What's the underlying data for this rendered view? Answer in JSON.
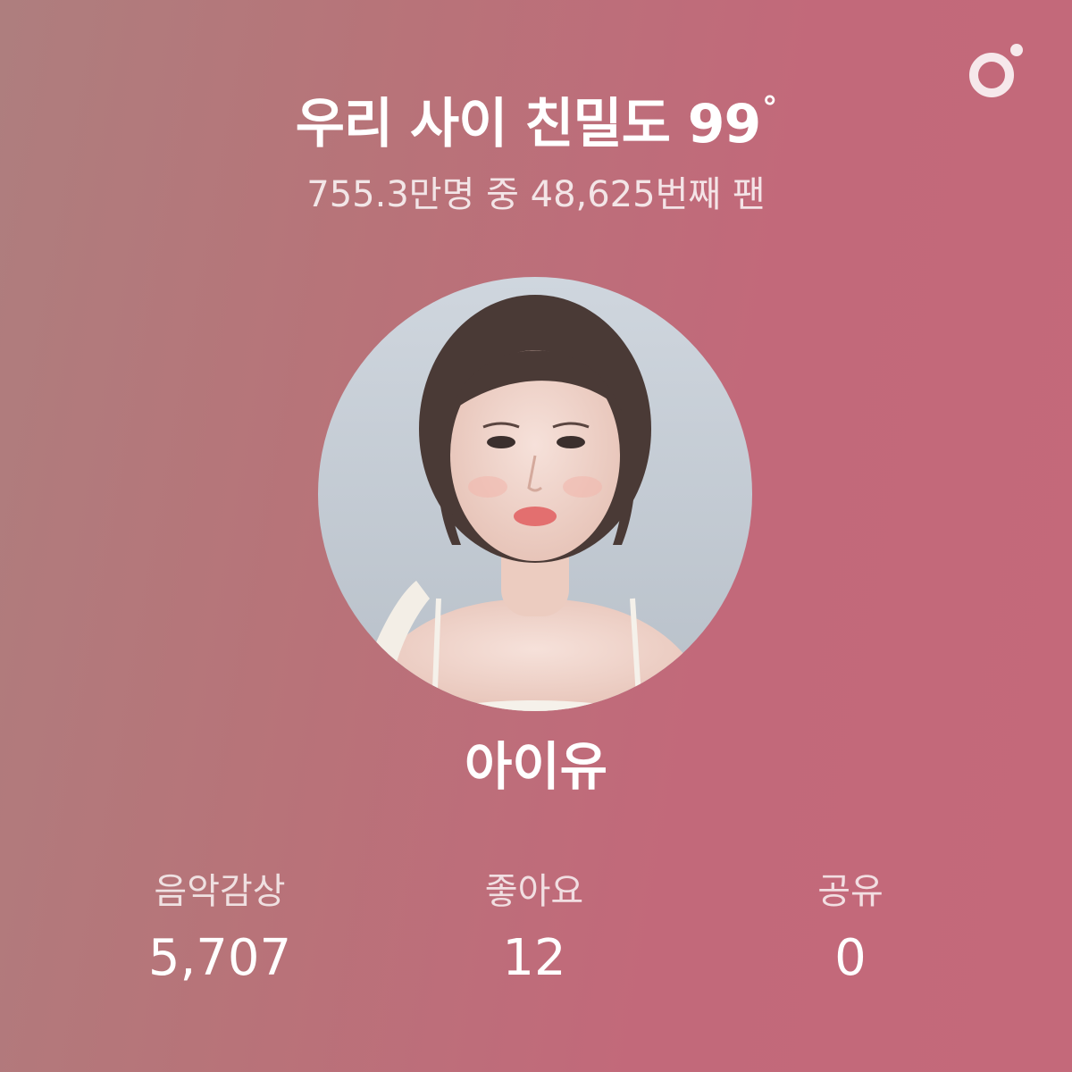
{
  "header": {
    "title": "우리 사이 친밀도 99",
    "degree_symbol": "°",
    "subtitle": "755.3만명 중 48,625번째 팬"
  },
  "logo": {
    "icon": "brand-logo-icon"
  },
  "artist": {
    "name": "아이유",
    "photo_icon": "artist-profile-photo"
  },
  "stats": [
    {
      "label": "음악감상",
      "value": "5,707"
    },
    {
      "label": "좋아요",
      "value": "12"
    },
    {
      "label": "공유",
      "value": "0"
    }
  ],
  "colors": {
    "background_left": "#ae7e7e",
    "background_right": "#c4697a",
    "text": "#ffffff"
  }
}
